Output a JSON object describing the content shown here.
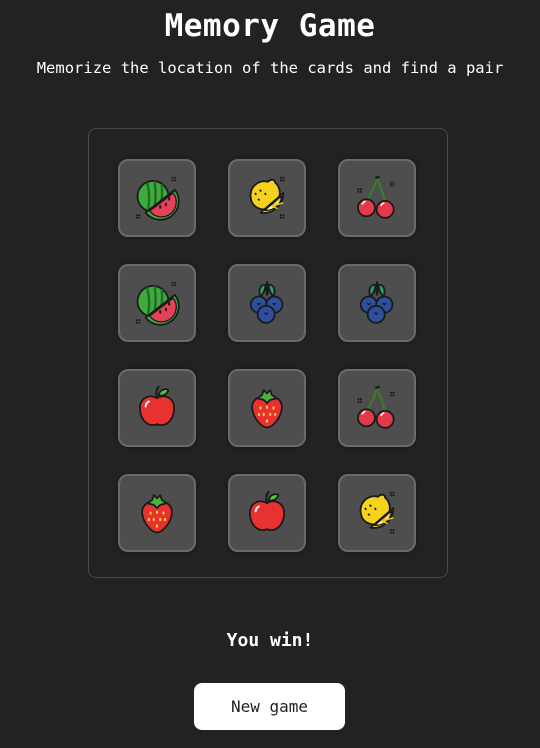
{
  "title": "Memory Game",
  "subtitle": "Memorize the location of the cards and find a pair",
  "status": "You win!",
  "new_game_label": "New game",
  "colors": {
    "background": "#222222",
    "card": "#4e4e4e",
    "card_border": "#6a6a6a",
    "button": "#ffffff"
  },
  "cards": [
    {
      "fruit": "watermelon-icon",
      "state": "matched"
    },
    {
      "fruit": "lemon-icon",
      "state": "matched"
    },
    {
      "fruit": "cherry-icon",
      "state": "matched"
    },
    {
      "fruit": "watermelon-icon",
      "state": "matched"
    },
    {
      "fruit": "blueberry-icon",
      "state": "matched"
    },
    {
      "fruit": "blueberry-icon",
      "state": "matched"
    },
    {
      "fruit": "apple-icon",
      "state": "matched"
    },
    {
      "fruit": "strawberry-icon",
      "state": "matched"
    },
    {
      "fruit": "cherry-icon",
      "state": "matched"
    },
    {
      "fruit": "strawberry-icon",
      "state": "matched"
    },
    {
      "fruit": "apple-icon",
      "state": "matched"
    },
    {
      "fruit": "lemon-icon",
      "state": "matched"
    }
  ]
}
